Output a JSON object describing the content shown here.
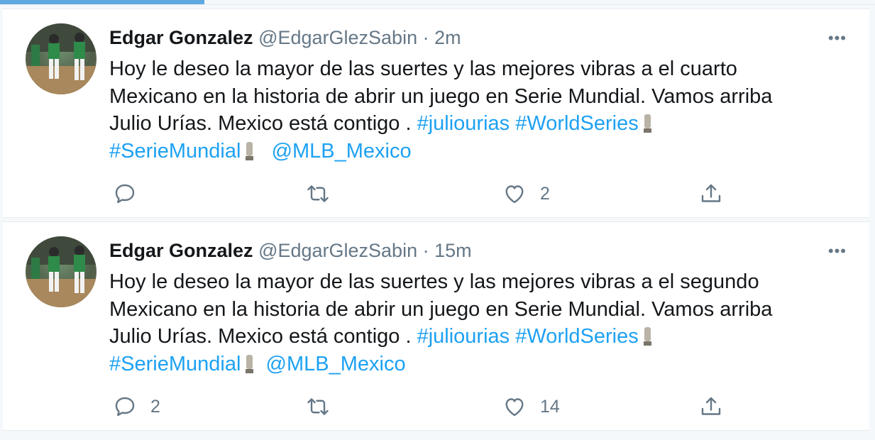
{
  "tweets": [
    {
      "name": "Edgar Gonzalez",
      "handle": "@EdgarGlezSabin",
      "dot": "·",
      "time": "2m",
      "line1": "Hoy le deseo la mayor de las suertes y las mejores vibras a el cuarto",
      "line2": "Mexicano en la historia de abrir un juego en Serie Mundial.  Vamos arriba",
      "line3_text": "Julio Urías.  Mexico está contigo . ",
      "hashtag1": "#juliourias",
      "hashtag2": "#WorldSeries",
      "hashtag3": "#SerieMundial",
      "mention": "@MLB_Mexico",
      "reply_count": "",
      "retweet_count": "",
      "like_count": "2"
    },
    {
      "name": "Edgar Gonzalez",
      "handle": "@EdgarGlezSabin",
      "dot": "·",
      "time": "15m",
      "line1": "Hoy le deseo la mayor de las suertes y las mejores vibras a el segundo",
      "line2": "Mexicano en la historia de abrir un juego en Serie Mundial.  Vamos arriba",
      "line3_text": "Julio Urías.  Mexico está contigo . ",
      "hashtag1": "#juliourias",
      "hashtag2": "#WorldSeries",
      "hashtag3": "#SerieMundial",
      "mention": "@MLB_Mexico",
      "reply_count": "2",
      "retweet_count": "",
      "like_count": "14"
    }
  ],
  "icons": {
    "more": "more-dots-icon",
    "reply": "reply-icon",
    "retweet": "retweet-icon",
    "like": "heart-icon",
    "share": "share-icon",
    "trophy": "trophy-emoji-icon"
  },
  "colors": {
    "link": "#1da1f2",
    "muted": "#657786",
    "text": "#14171a",
    "tab_indicator": "#5fa8e0"
  }
}
